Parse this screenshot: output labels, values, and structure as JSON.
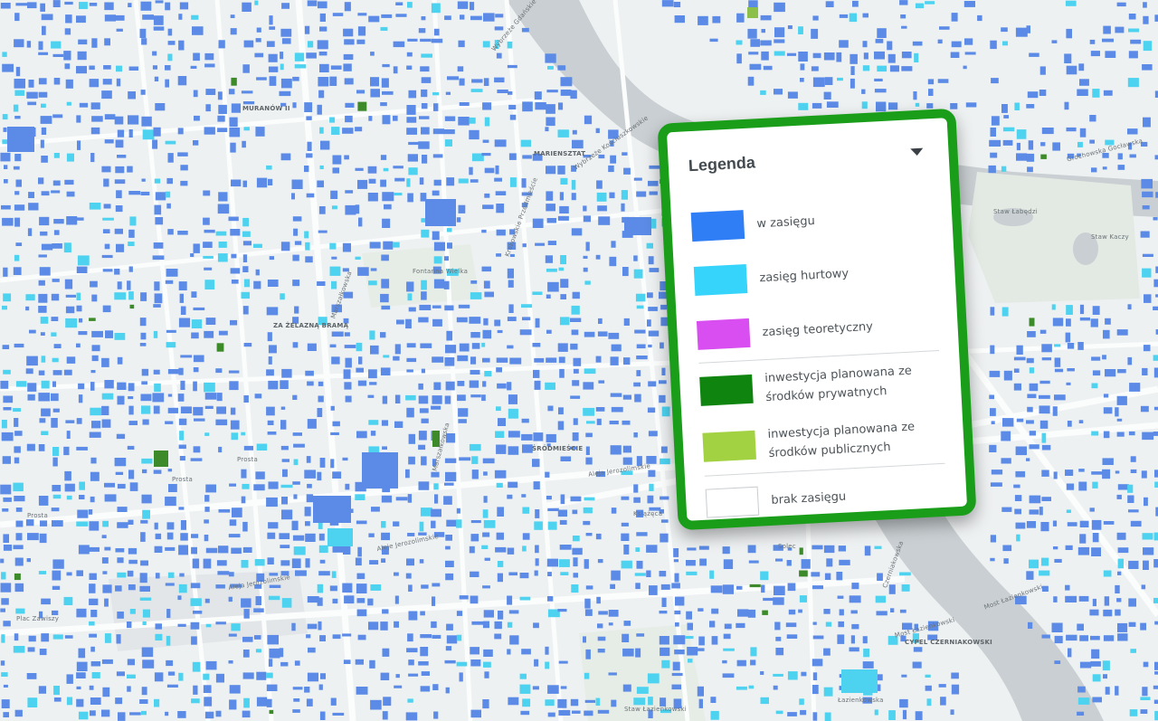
{
  "map": {
    "colors": {
      "background": "#eef1f2",
      "water": "#c9cfd2",
      "park": "#e3e9e3",
      "road": "#fbfcfc",
      "in_range": "#5b8be6",
      "wholesale": "#4dd2f0",
      "private_investment": "#3d8a2a",
      "public_investment": "#8cc04a"
    },
    "labels": [
      "MURANÓW II",
      "MARIENSZTAT",
      "ZA ŻELAZNĄ BRAMĄ",
      "ŚRÓDMIEŚCIE",
      "CYPEL CZERNIAKOWSKI",
      "Fontanna Wielka",
      "Staw Łabędzi",
      "Staw Kaczy",
      "Aleje Jerozolimskie",
      "Aleja Jerozolimskie",
      "Aleja Jerozolimskie",
      "Prosta",
      "Prosta",
      "Prosta",
      "Most Łazienkowski",
      "Most Łazienkowski",
      "Wybrzeże Gdańskie",
      "Wybrzeże Kościuszkowskie",
      "Grochowska Gocławska",
      "Marszałkowska",
      "Marszałkowska",
      "Książęca",
      "Krakowskie Przedmieście",
      "Solec",
      "Plac Zawiszy",
      "Czerniakowska",
      "Łazienkowska",
      "Staw Łazienkowski"
    ]
  },
  "legend": {
    "title": "Legenda",
    "caret_icon": "caret-down-icon",
    "items": [
      {
        "label": "w zasięgu",
        "color": "#2f7ef5"
      },
      {
        "label": "zasięg hurtowy",
        "color": "#36d4fa"
      },
      {
        "label": "zasięg teoretyczny",
        "color": "#d94ef0"
      },
      {
        "label_line1": "inwestycja planowana ze",
        "label_line2": "środków prywatnych",
        "color": "#0f850f"
      },
      {
        "label_line1": "inwestycja planowana ze",
        "label_line2": "środków publicznych",
        "color": "#a2d141"
      },
      {
        "label": "brak zasięgu",
        "color": "#ffffff"
      }
    ],
    "highlight_color": "#1a9e1a"
  }
}
